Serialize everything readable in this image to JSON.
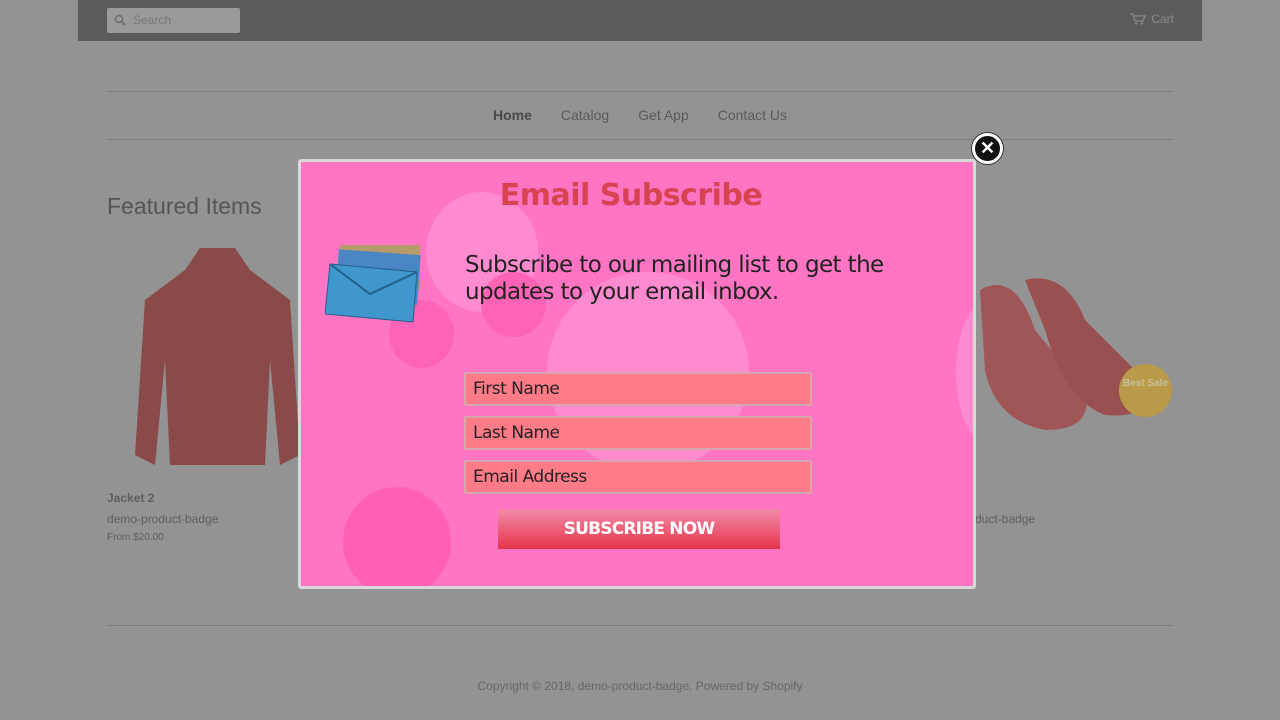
{
  "header": {
    "search_placeholder": "Search",
    "cart_label": "Cart"
  },
  "nav": [
    {
      "label": "Home"
    },
    {
      "label": "Catalog"
    },
    {
      "label": "Get App"
    },
    {
      "label": "Contact Us"
    }
  ],
  "featured_title": "Featured Items",
  "products": [
    {
      "name": "Jacket 2",
      "vendor": "demo-product-badge",
      "price": "From $20.00"
    },
    {
      "vendor_partial": "duct-badge",
      "badge": "Best Sale"
    }
  ],
  "footer": {
    "copyright": "Copyright © 2018, demo-product-badge. Powered by Shopify"
  },
  "popup": {
    "title": "Email Subscribe",
    "description": "Subscribe to our mailing list to get the updates to your email inbox.",
    "fields": [
      {
        "placeholder": "First Name"
      },
      {
        "placeholder": "Last Name"
      },
      {
        "placeholder": "Email Address"
      }
    ],
    "button": "SUBSCRIBE NOW",
    "close_icon": "close-icon",
    "colors": {
      "background": "#ff75c3",
      "title": "#d84352",
      "button": "#e4354a"
    }
  }
}
